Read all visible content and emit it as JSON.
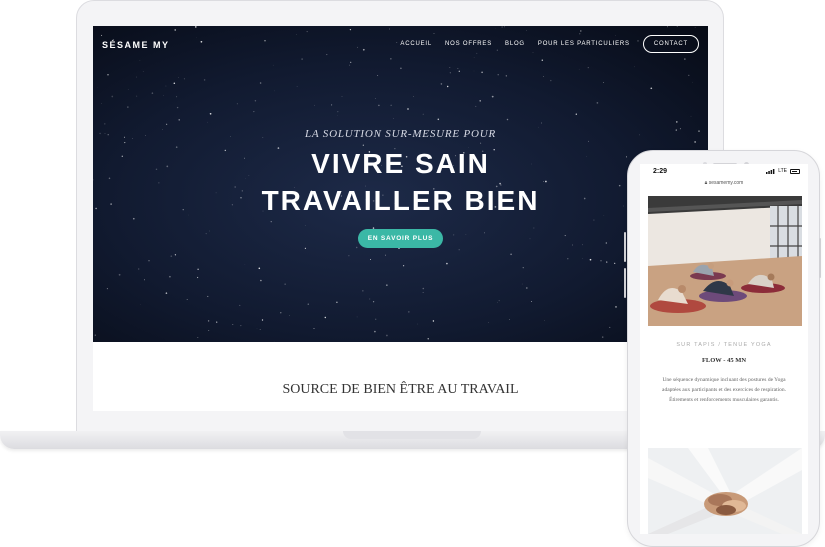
{
  "laptop": {
    "nav": {
      "logo": "SÉSAME MY",
      "links": [
        "ACCUEIL",
        "NOS OFFRES",
        "BLOG",
        "POUR LES PARTICULIERS"
      ],
      "contact": "CONTACT"
    },
    "hero": {
      "subtitle": "LA SOLUTION SUR-MESURE POUR",
      "title_line1": "VIVRE SAIN",
      "title_line2": "TRAVAILLER BIEN",
      "cta": "EN SAVOIR PLUS"
    },
    "section_title": "SOURCE DE BIEN ÊTRE AU TRAVAIL",
    "colors": {
      "hero_bg": "#111a30",
      "accent": "#3bb8a6"
    }
  },
  "phone": {
    "status": {
      "time": "2:29",
      "network": "LTE"
    },
    "url": "sesamemy.com",
    "card": {
      "kicker": "SUR TAPIS / TENUE YOGA",
      "title": "FLOW - 45 MN",
      "description": "Une séquence dynamique incluant des postures de Yoga adaptées aux participants et des exercices de respiration. Étirements et renforcements musculaires garantis."
    }
  }
}
